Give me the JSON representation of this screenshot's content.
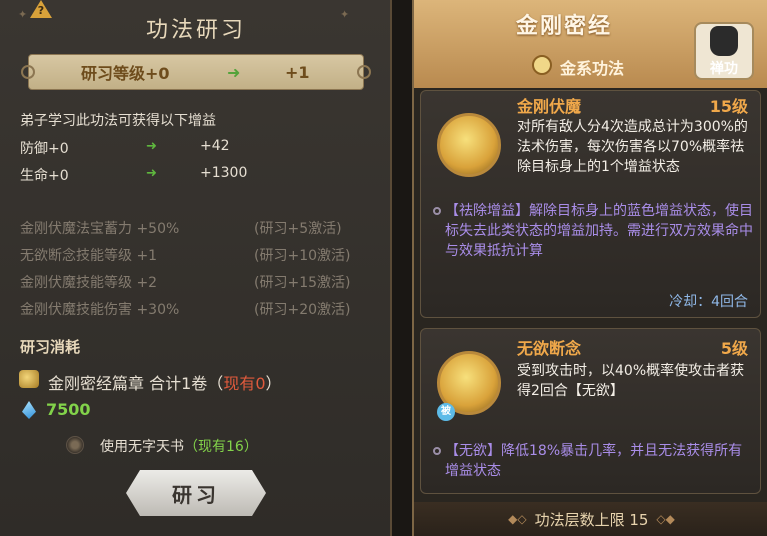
{
  "left": {
    "title": "功法研习",
    "level": {
      "label": "研习等级+0",
      "to": "+1"
    },
    "benefit_intro": "弟子学习此功法可获得以下增益",
    "stats": [
      {
        "label": "防御+0",
        "value": "+42"
      },
      {
        "label": "生命+0",
        "value": "+1300"
      }
    ],
    "bonuses": [
      {
        "text": "金刚伏魔法宝蓄力 +50%",
        "unlock": "(研习+5激活)"
      },
      {
        "text": "无欲断念技能等级 +1",
        "unlock": "(研习+10激活)"
      },
      {
        "text": "金刚伏魔技能等级 +2",
        "unlock": "(研习+15激活)"
      },
      {
        "text": "金刚伏魔技能伤害 +30%",
        "unlock": "(研习+20激活)"
      }
    ],
    "cost_title": "研习消耗",
    "cost": {
      "item": "金刚密经篇章",
      "total": "合计1卷",
      "owned_prefix": "（",
      "owned": "现有0",
      "owned_suffix": "）"
    },
    "gems": "7500",
    "use_book": {
      "label": "使用无字天书",
      "owned": "（现有16）"
    },
    "study_button": "研习"
  },
  "right": {
    "title": "金刚密经",
    "subtitle": "金系功法",
    "badge": "禅功",
    "skills": [
      {
        "name": "金刚伏魔",
        "level": "15级",
        "desc": "对所有敌人分4次造成总计为300%的法术伤害，每次伤害各以70%概率祛除目标身上的1个增益状态",
        "extra": "【祛除增益】解除目标身上的蓝色增益状态，使目标失去此类状态的增益加持。需进行双方效果命中与效果抵抗计算",
        "cooldown": "冷却：4回合"
      },
      {
        "name": "无欲断念",
        "level": "5级",
        "desc": "受到攻击时，以40%概率使攻击者获得2回合【无欲】",
        "badge": "被",
        "extra": "【无欲】降低18%暴击几率，并且无法获得所有增益状态"
      }
    ],
    "footer": "功法层数上限 15"
  },
  "colors": {
    "accent_gold": "#f0a84a",
    "green": "#82d24a",
    "purple": "#a98de8",
    "red": "#e05a3c"
  }
}
